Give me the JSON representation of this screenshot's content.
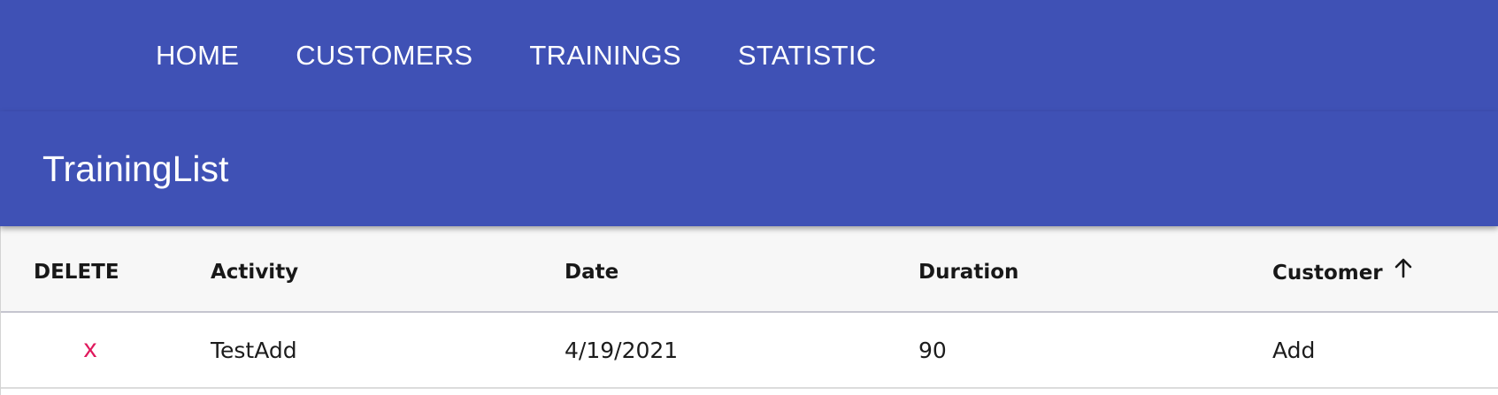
{
  "nav": {
    "links": [
      "HOME",
      "CUSTOMERS",
      "TRAININGS",
      "STATISTIC"
    ]
  },
  "page": {
    "title": "TrainingList"
  },
  "table": {
    "columns": [
      "DELETE",
      "Activity",
      "Date",
      "Duration",
      "Customer"
    ],
    "sort": {
      "column": "Customer",
      "direction": "ascending",
      "icon": "arrow-up-icon"
    },
    "rows": [
      {
        "delete_label": "x",
        "activity": "TestAdd",
        "date": "4/19/2021",
        "duration": "90",
        "customer": "Add"
      }
    ]
  },
  "colors": {
    "primary": "#3f51b5",
    "delete_accent": "#e0185c",
    "header_background": "#f7f7f7"
  }
}
